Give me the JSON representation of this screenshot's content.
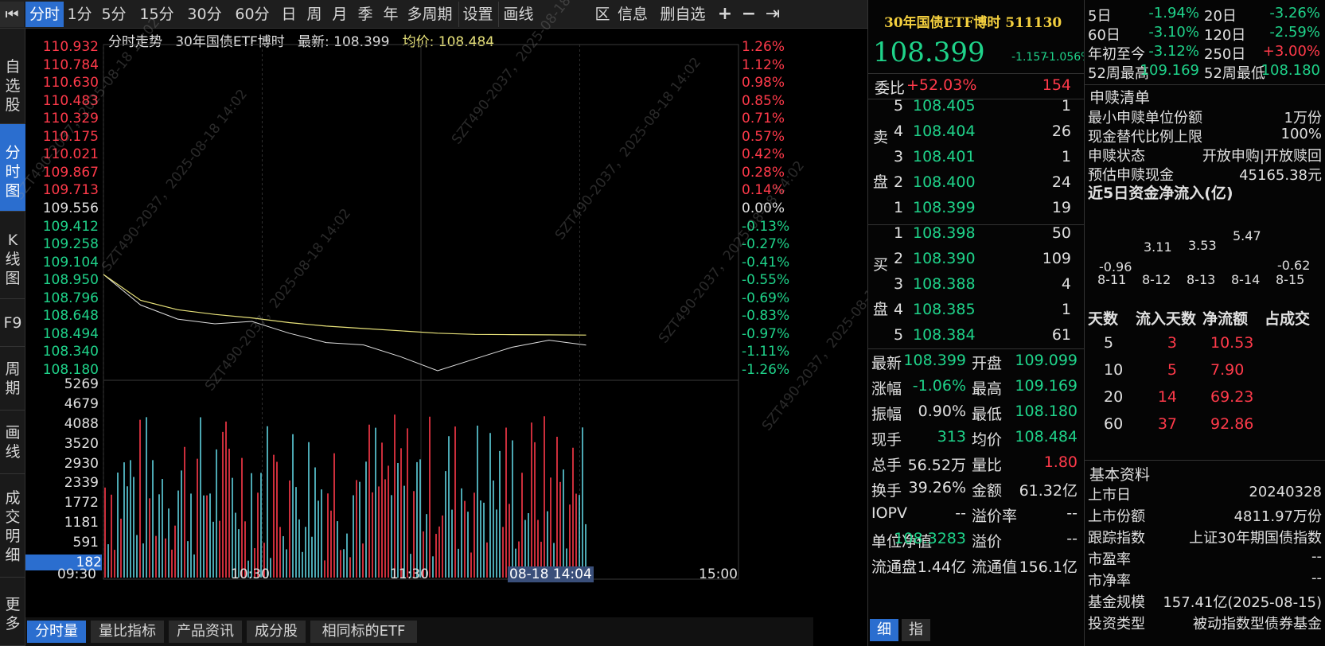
{
  "toolbar": {
    "first_icon": "⏮",
    "tabs": [
      "分时",
      "1分",
      "5分",
      "15分",
      "30分",
      "60分",
      "日",
      "周",
      "月",
      "季",
      "年",
      "多周期",
      "设置",
      "画线"
    ],
    "active_tab": "分时",
    "right_items": [
      "区",
      "信息",
      "删自选",
      "+",
      "−",
      "⇥"
    ]
  },
  "leftnav": {
    "items": [
      "自选股",
      "分时图",
      "K线图",
      "F9",
      "周期",
      "画线",
      "成交明细",
      "更多"
    ],
    "active": "分时图"
  },
  "chart": {
    "header_title": "分时走势",
    "header_name": "30年国债ETF博时",
    "latest_label": "最新:",
    "latest_value": "108.399",
    "avg_label": "均价:",
    "avg_value": "108.484",
    "price_ticks": [
      "110.932",
      "110.784",
      "110.630",
      "110.483",
      "110.329",
      "110.175",
      "110.021",
      "109.867",
      "109.713",
      "109.556",
      "109.412",
      "109.258",
      "109.104",
      "108.950",
      "108.796",
      "108.648",
      "108.494",
      "108.340",
      "108.180"
    ],
    "pct_ticks": [
      "1.26%",
      "1.12%",
      "0.98%",
      "0.85%",
      "0.71%",
      "0.57%",
      "0.42%",
      "0.28%",
      "0.14%",
      "0.00%",
      "-0.13%",
      "-0.27%",
      "-0.41%",
      "-0.55%",
      "-0.69%",
      "-0.83%",
      "-0.97%",
      "-1.11%",
      "-1.26%"
    ],
    "volume_ticks": [
      "5269",
      "4679",
      "4088",
      "3520",
      "2930",
      "2339",
      "1772",
      "1181",
      "591",
      "182"
    ],
    "time_labels": [
      "09:30",
      "10:30",
      "11:30",
      "08-18 14:04",
      "15:00"
    ],
    "watermark": "SZT490-2037，2025-08-18 14:02"
  },
  "chart_data": {
    "type": "line",
    "title": "分时走势",
    "xlabel": "",
    "ylabel": "",
    "ylim": [
      108.18,
      110.932
    ],
    "prev_close": 109.556,
    "x": [
      "09:30",
      "09:45",
      "10:00",
      "10:15",
      "10:30",
      "10:45",
      "11:00",
      "11:15",
      "11:30",
      "13:15",
      "13:30",
      "13:45",
      "14:00",
      "14:04"
    ],
    "series": [
      {
        "name": "最新",
        "values": [
          109.0,
          108.74,
          108.62,
          108.58,
          108.6,
          108.5,
          108.42,
          108.4,
          108.3,
          108.18,
          108.28,
          108.38,
          108.44,
          108.399
        ]
      },
      {
        "name": "均价",
        "values": [
          109.0,
          108.78,
          108.7,
          108.66,
          108.63,
          108.59,
          108.56,
          108.54,
          108.52,
          108.5,
          108.49,
          108.488,
          108.486,
          108.484
        ]
      }
    ]
  },
  "bottom_tabs": [
    "分时量",
    "量比指标",
    "产品资讯",
    "成分股",
    "相同标的ETF"
  ],
  "quote": {
    "title": "30年国债ETF博时",
    "code": "511130",
    "price": "108.399",
    "change": "-1.157",
    "change_pct": "-1.056%",
    "weibi_label": "委比",
    "weibi_value": "+52.03%",
    "weibi_count": "154",
    "sell_label": [
      "卖",
      "盘"
    ],
    "buy_label": [
      "买",
      "盘"
    ],
    "asks": [
      {
        "level": "5",
        "price": "108.405",
        "vol": "1"
      },
      {
        "level": "4",
        "price": "108.404",
        "vol": "26"
      },
      {
        "level": "3",
        "price": "108.401",
        "vol": "1"
      },
      {
        "level": "2",
        "price": "108.400",
        "vol": "24"
      },
      {
        "level": "1",
        "price": "108.399",
        "vol": "19"
      }
    ],
    "bids": [
      {
        "level": "1",
        "price": "108.398",
        "vol": "50"
      },
      {
        "level": "2",
        "price": "108.390",
        "vol": "109"
      },
      {
        "level": "3",
        "price": "108.388",
        "vol": "4"
      },
      {
        "level": "4",
        "price": "108.385",
        "vol": "1"
      },
      {
        "level": "5",
        "price": "108.384",
        "vol": "61"
      }
    ],
    "stats": [
      {
        "l1": "最新",
        "v1": "108.399",
        "c1": "green",
        "l2": "开盘",
        "v2": "109.099",
        "c2": "green"
      },
      {
        "l1": "涨幅",
        "v1": "-1.06%",
        "c1": "green",
        "l2": "最高",
        "v2": "109.169",
        "c2": "green"
      },
      {
        "l1": "振幅",
        "v1": "0.90%",
        "c1": "white",
        "l2": "最低",
        "v2": "108.180",
        "c2": "green"
      },
      {
        "l1": "现手",
        "v1": "313",
        "c1": "green",
        "l2": "均价",
        "v2": "108.484",
        "c2": "green"
      },
      {
        "l1": "总手",
        "v1": "56.52万",
        "c1": "white",
        "l2": "量比",
        "v2": "1.80",
        "c2": "red"
      },
      {
        "l1": "换手",
        "v1": "39.26%",
        "c1": "white",
        "l2": "金额",
        "v2": "61.32亿",
        "c2": "white"
      },
      {
        "l1": "IOPV",
        "v1": "--",
        "c1": "white",
        "l2": "溢价率",
        "v2": "--",
        "c2": "white"
      },
      {
        "l1": "单位净值",
        "v1": "108.3283",
        "c1": "green",
        "l2": "溢价",
        "v2": "--",
        "c2": "white"
      },
      {
        "l1": "流通盘",
        "v1": "1.44亿",
        "c1": "white",
        "l2": "流通值",
        "v2": "156.1亿",
        "c2": "white"
      }
    ],
    "footer_tabs": [
      "细",
      "指"
    ]
  },
  "info": {
    "periods": [
      {
        "l1": "5日",
        "v1": "-1.94%",
        "c1": "green",
        "l2": "20日",
        "v2": "-3.26%",
        "c2": "green"
      },
      {
        "l1": "60日",
        "v1": "-3.10%",
        "c1": "green",
        "l2": "120日",
        "v2": "-2.59%",
        "c2": "green"
      },
      {
        "l1": "年初至今",
        "v1": "-3.12%",
        "c1": "green",
        "l2": "250日",
        "v2": "+3.00%",
        "c2": "red"
      },
      {
        "l1": "52周最高",
        "v1": "109.169",
        "c1": "green",
        "l2": "52周最低",
        "v2": "108.180",
        "c2": "green"
      }
    ],
    "redeem_title": "申赎清单",
    "redeem": [
      {
        "k": "最小申赎单位份额",
        "v": "1万份"
      },
      {
        "k": "现金替代比例上限",
        "v": "100%"
      },
      {
        "k": "申赎状态",
        "v": "开放申购|开放赎回"
      },
      {
        "k": "预估申赎现金",
        "v": "45165.38元"
      }
    ],
    "flow_title": "近5日资金净流入(亿)",
    "flow_dates": [
      "8-11",
      "8-12",
      "8-13",
      "8-14",
      "8-15"
    ],
    "flow_values": [
      "-0.96",
      "3.11",
      "3.53",
      "5.47",
      "-0.62"
    ],
    "flow_table_headers": [
      "天数",
      "流入天数",
      "净流额",
      "占成交"
    ],
    "flow_table": [
      {
        "days": "5",
        "in_days": "3",
        "net": "10.53"
      },
      {
        "days": "10",
        "in_days": "5",
        "net": "7.90"
      },
      {
        "days": "20",
        "in_days": "14",
        "net": "69.23"
      },
      {
        "days": "60",
        "in_days": "37",
        "net": "92.86"
      }
    ],
    "basic_title": "基本资料",
    "basic": [
      {
        "k": "上市日",
        "v": "20240328"
      },
      {
        "k": "上市份额",
        "v": "4811.97万份"
      },
      {
        "k": "跟踪指数",
        "v": "上证30年期国债指数"
      },
      {
        "k": "市盈率",
        "v": "--"
      },
      {
        "k": "市净率",
        "v": "--"
      },
      {
        "k": "基金规模",
        "v": "157.41亿(2025-08-15)"
      },
      {
        "k": "投资类型",
        "v": "被动指数型债券基金"
      }
    ]
  },
  "colors": {
    "up": "#ff3a4a",
    "down": "#1fd38a",
    "accent": "#2b6ecf",
    "avg_line": "#e8e27a",
    "price_line": "#e0e0e0"
  }
}
